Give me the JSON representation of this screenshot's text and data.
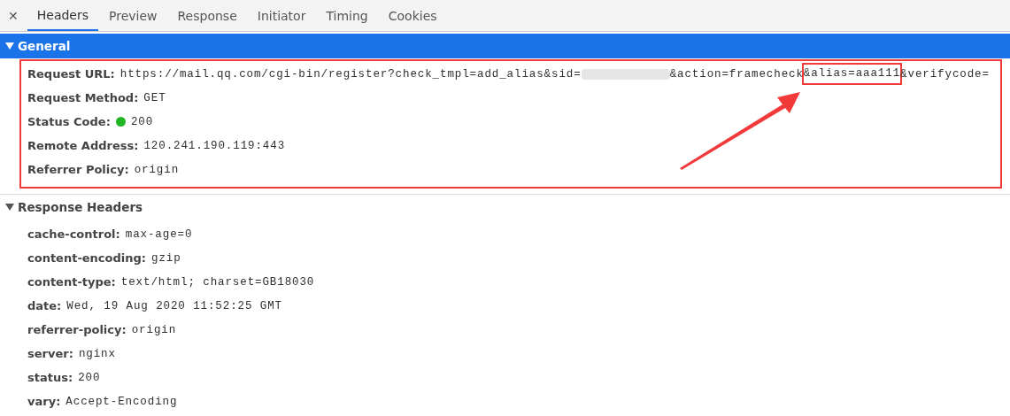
{
  "close_label": "✕",
  "tabs": [
    {
      "label": "Headers",
      "selected": true
    },
    {
      "label": "Preview",
      "selected": false
    },
    {
      "label": "Response",
      "selected": false
    },
    {
      "label": "Initiator",
      "selected": false
    },
    {
      "label": "Timing",
      "selected": false
    },
    {
      "label": "Cookies",
      "selected": false
    }
  ],
  "sections": [
    {
      "title": "General",
      "expanded": true,
      "highlighted": true,
      "rows": [
        {
          "name": "Request URL:",
          "value": "https://mail.qq.com/cgi-bin/register?check_tmpl=add_alias&sid=",
          "redacted": true,
          "value_after": [
            {
              "text": "&action=framecheck",
              "boxed": false
            },
            {
              "text": "&alias=aaa111",
              "boxed": true
            },
            {
              "text": "&verifycode=",
              "boxed": false
            }
          ]
        },
        {
          "name": "Request Method:",
          "value": "GET"
        },
        {
          "name": "Status Code:",
          "value": "200",
          "color": "#22b422"
        },
        {
          "name": "Remote Address:",
          "value": "120.241.190.119:443"
        },
        {
          "name": "Referrer Policy:",
          "value": "origin"
        }
      ]
    },
    {
      "title": "Response Headers",
      "expanded": true,
      "highlighted": false,
      "rows": [
        {
          "name": "cache-control:",
          "value": "max-age=0"
        },
        {
          "name": "content-encoding:",
          "value": "gzip"
        },
        {
          "name": "content-type:",
          "value": "text/html; charset=GB18030"
        },
        {
          "name": "date:",
          "value": "Wed, 19 Aug 2020 11:52:25 GMT"
        },
        {
          "name": "referrer-policy:",
          "value": "origin"
        },
        {
          "name": "server:",
          "value": "nginx"
        },
        {
          "name": "status:",
          "value": "200"
        },
        {
          "name": "vary:",
          "value": "Accept-Encoding"
        }
      ]
    }
  ]
}
